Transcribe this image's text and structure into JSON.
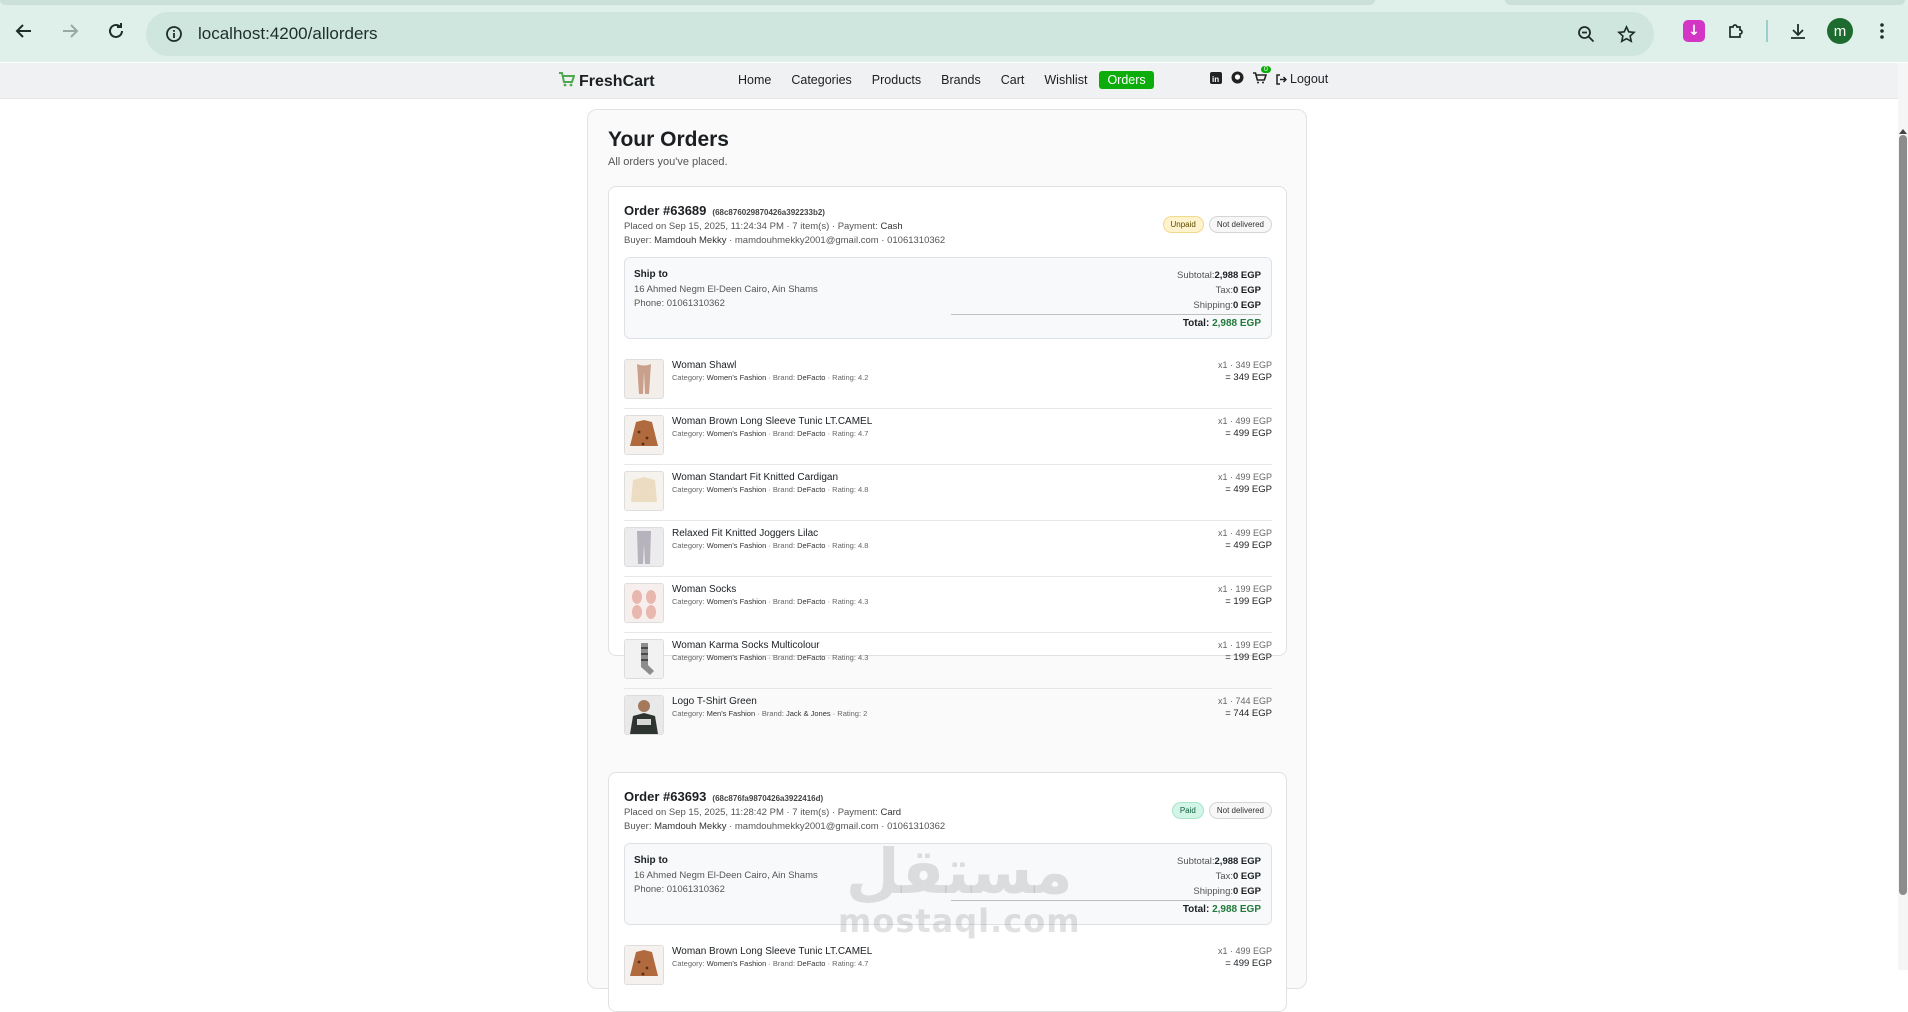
{
  "browser": {
    "url": "localhost:4200/allorders",
    "avatar_letter": "m"
  },
  "app": {
    "brand": "FreshCart",
    "menu": [
      "Home",
      "Categories",
      "Products",
      "Brands",
      "Cart",
      "Wishlist",
      "Orders"
    ],
    "active_menu": "Orders",
    "cart_count": "0",
    "logout": "Logout",
    "accent": "#0aad0a"
  },
  "page": {
    "title": "Your Orders",
    "subtitle": "All orders you've placed."
  },
  "orders": [
    {
      "title": "Order #63689",
      "id": "(68c876029870426a392233b2)",
      "meta_prefix": "Placed on Sep 15, 2025, 11:24:34 PM · 7 item(s) · Payment: ",
      "payment": "Cash",
      "buyer_prefix": "Buyer: ",
      "buyer_name": "Mamdouh Mekky",
      "buyer_contact": " · mamdouhmekky2001@gmail.com · 01061310362",
      "payment_status": "Unpaid",
      "delivery_status": "Not delivered",
      "ship_to_label": "Ship to",
      "address": "16 Ahmed Negm El-Deen Cairo, Ain Shams",
      "phone": "Phone: 01061310362",
      "subtotal_label": "Subtotal:",
      "subtotal": "2,988 EGP",
      "tax_label": "Tax:",
      "tax": "0 EGP",
      "shipping_label": "Shipping:",
      "shipping": "0 EGP",
      "total_label": "Total: ",
      "total": "2,988 EGP",
      "items": [
        {
          "name": "Woman Shawl",
          "category": "Women's Fashion",
          "brand": "DeFacto",
          "rating": "4.2",
          "qty": "x1 · 349 EGP",
          "sum": "= 349 EGP",
          "thumb": "shawl"
        },
        {
          "name": "Woman Brown Long Sleeve Tunic LT.CAMEL",
          "category": "Women's Fashion",
          "brand": "DeFacto",
          "rating": "4.7",
          "qty": "x1 · 499 EGP",
          "sum": "= 499 EGP",
          "thumb": "tunic"
        },
        {
          "name": "Woman Standart Fit Knitted Cardigan",
          "category": "Women's Fashion",
          "brand": "DeFacto",
          "rating": "4.8",
          "qty": "x1 · 499 EGP",
          "sum": "= 499 EGP",
          "thumb": "cardigan"
        },
        {
          "name": "Relaxed Fit Knitted Joggers Lilac",
          "category": "Women's Fashion",
          "brand": "DeFacto",
          "rating": "4.8",
          "qty": "x1 · 499 EGP",
          "sum": "= 499 EGP",
          "thumb": "joggers"
        },
        {
          "name": "Woman Socks",
          "category": "Women's Fashion",
          "brand": "DeFacto",
          "rating": "4.3",
          "qty": "x1 · 199 EGP",
          "sum": "= 199 EGP",
          "thumb": "socks"
        },
        {
          "name": "Woman Karma Socks Multicolour",
          "category": "Women's Fashion",
          "brand": "DeFacto",
          "rating": "4.3",
          "qty": "x1 · 199 EGP",
          "sum": "= 199 EGP",
          "thumb": "karma"
        },
        {
          "name": "Logo T-Shirt Green",
          "category": "Men's Fashion",
          "brand": "Jack & Jones",
          "rating": "2",
          "qty": "x1 · 744 EGP",
          "sum": "= 744 EGP",
          "thumb": "tshirt"
        }
      ]
    },
    {
      "title": "Order #63693",
      "id": "(68c876fa9870426a3922416d)",
      "meta_prefix": "Placed on Sep 15, 2025, 11:28:42 PM · 7 item(s) · Payment: ",
      "payment": "Card",
      "buyer_prefix": "Buyer: ",
      "buyer_name": "Mamdouh Mekky",
      "buyer_contact": " · mamdouhmekky2001@gmail.com · 01061310362",
      "payment_status": "Paid",
      "delivery_status": "Not delivered",
      "ship_to_label": "Ship to",
      "address": "16 Ahmed Negm El-Deen Cairo, Ain Shams",
      "phone": "Phone: 01061310362",
      "subtotal_label": "Subtotal:",
      "subtotal": "2,988 EGP",
      "tax_label": "Tax:",
      "tax": "0 EGP",
      "shipping_label": "Shipping:",
      "shipping": "0 EGP",
      "total_label": "Total: ",
      "total": "2,988 EGP",
      "items": [
        {
          "name": "Woman Brown Long Sleeve Tunic LT.CAMEL",
          "category": "Women's Fashion",
          "brand": "DeFacto",
          "rating": "4.7",
          "qty": "x1 · 499 EGP",
          "sum": "= 499 EGP",
          "thumb": "tunic"
        }
      ]
    }
  ],
  "item_labels": {
    "category": "Category: ",
    "brand": " · Brand: ",
    "rating": " · Rating: "
  },
  "watermark": {
    "arabic": "مستقل",
    "latin": "mostaql.com"
  }
}
